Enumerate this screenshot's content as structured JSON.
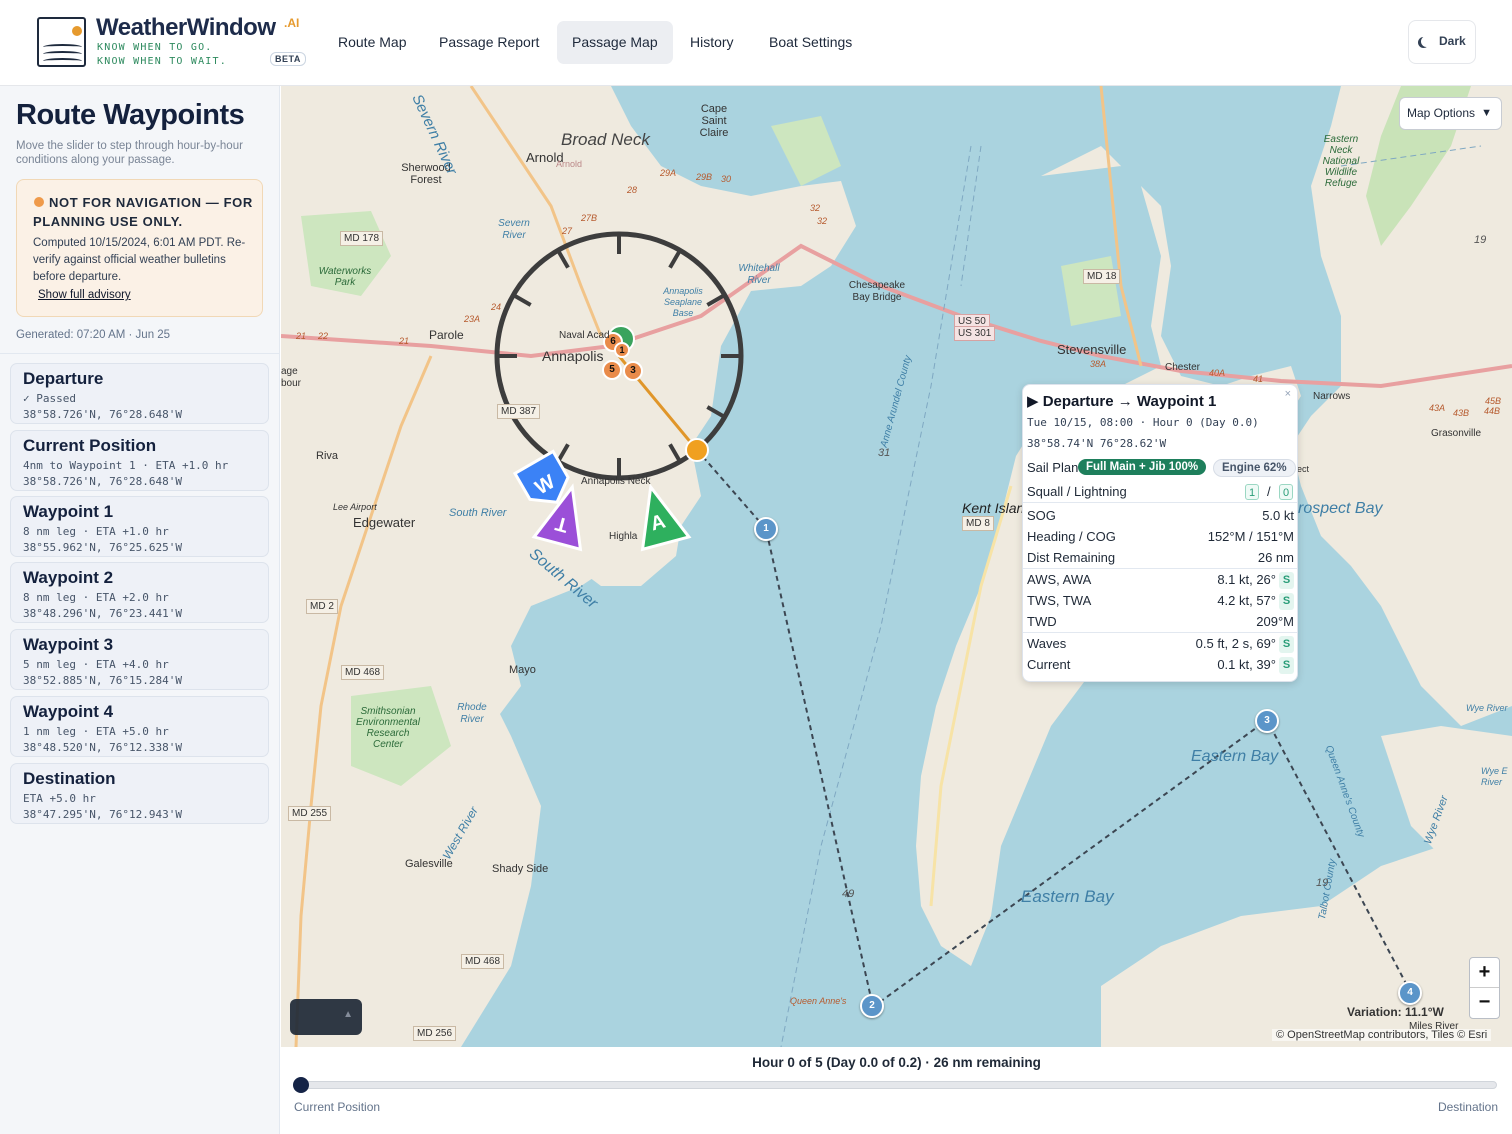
{
  "brand": {
    "name": "WeatherWindow",
    "suffix": ".AI",
    "tagline1": "KNOW WHEN TO GO.",
    "tagline2": "KNOW WHEN TO WAIT.",
    "badge": "BETA"
  },
  "nav": {
    "items": [
      "Route Map",
      "Passage Report",
      "Passage Map",
      "History",
      "Boat Settings"
    ],
    "active": "Passage Map",
    "theme_button": "Dark"
  },
  "sidebar": {
    "title": "Route Waypoints",
    "subtitle": "Move the slider to step through hour-by-hour conditions along your passage.",
    "advisory": {
      "heading": "NOT FOR NAVIGATION — FOR PLANNING USE ONLY.",
      "body": "Computed 10/15/2024, 6:01 AM PDT. Re-verify against official weather bulletins before departure.",
      "link": "Show full advisory",
      "dot_color": "#ef9a4a"
    },
    "generated": "Generated: 07:20 AM · Jun 25",
    "waypoints": [
      {
        "title": "Departure",
        "status": "✓ Passed",
        "coords": "38°58.726'N, 76°28.648'W"
      },
      {
        "title": "Current Position",
        "status": "4nm to Waypoint 1 · ETA +1.0 hr",
        "coords": "38°58.726'N, 76°28.648'W"
      },
      {
        "title": "Waypoint 1",
        "status": "8 nm leg · ETA +1.0 hr",
        "coords": "38°55.962'N, 76°25.625'W"
      },
      {
        "title": "Waypoint 2",
        "status": "8 nm leg · ETA +2.0 hr",
        "coords": "38°48.296'N, 76°23.441'W"
      },
      {
        "title": "Waypoint 3",
        "status": "5 nm leg · ETA +4.0 hr",
        "coords": "38°52.885'N, 76°15.284'W"
      },
      {
        "title": "Waypoint 4",
        "status": "1 nm leg · ETA +5.0 hr",
        "coords": "38°48.520'N, 76°12.338'W"
      },
      {
        "title": "Destination",
        "status": "ETA +5.0 hr",
        "coords": "38°47.295'N, 76°12.943'W"
      }
    ]
  },
  "map": {
    "options_label": "Map Options",
    "options_arrow": "▼",
    "zoom_in": "+",
    "zoom_out": "−",
    "attribution": "© OpenStreetMap contributors, Tiles © Esri",
    "variation": "Variation: 11.1°W",
    "legend_toggle": "▲",
    "wind_markers": {
      "apparent": "A",
      "true": "T",
      "wave": "W"
    },
    "waypoint_markers": [
      "1",
      "2",
      "3",
      "4"
    ],
    "cluster_markers": [
      "6",
      "5",
      "3",
      "1"
    ],
    "places": {
      "broad_neck": "Broad Neck",
      "arnold": "Arnold",
      "arnold2": "Arnold",
      "cape_saint_claire": "Cape Saint Claire",
      "sherwood_forest": "Sherwood Forest",
      "annapolis": "Annapolis",
      "naval_academy": "Naval Acad",
      "parole": "Parole",
      "riva": "Riva",
      "edgewater": "Edgewater",
      "annapolis_neck": "Annapolis Neck",
      "highland": "Highla",
      "mayo": "Mayo",
      "galesville": "Galesville",
      "shady_side": "Shady Side",
      "stevensville": "Stevensville",
      "chester": "Chester",
      "grasonville": "Grasonville",
      "narrows": "Narrows",
      "kent_island": "Kent Islan",
      "bay_bridge": "Chesapeake Bay Bridge",
      "lee_airport": "Lee Airport",
      "seaplane_base": "Annapolis Seaplane Base",
      "queen_annes": "Queen Anne's",
      "anne_arundel_county": "Anne Arundel County",
      "queen_annes_county": "Queen Anne's County",
      "talbot_county": "Talbot County",
      "age": "age",
      "bour": "bour",
      "ect": "ect",
      "miles_river": "Miles River"
    },
    "water": {
      "severn_river": "Severn River",
      "severn_river2": "Severn River",
      "whitehall_river": "Whitehall River",
      "south_river": "South River",
      "south_river2": "South River",
      "rhode_river": "Rhode River",
      "west_river": "West River",
      "eastern_bay": "Eastern Bay",
      "eastern_bay2": "Eastern Bay",
      "prospect_bay": "rospect Bay",
      "wye_river": "Wye River",
      "wye_river2": "Wye River",
      "wye_east": "Wye E River"
    },
    "green": {
      "waterworks": "Waterworks Park",
      "smithsonian": "Smithsonian Environmental Research Center",
      "eastern_neck": "Eastern Neck National Wildlife Refuge"
    },
    "shields": {
      "md178": "MD 178",
      "md18": "MD 18",
      "us50": "US 50",
      "us301": "US 301",
      "md387": "MD 387",
      "md2": "MD 2",
      "md468": "MD 468",
      "md468b": "MD 468",
      "md255": "MD 255",
      "md256": "MD 256",
      "md8": "MD 8"
    },
    "road_numbers": [
      "29A",
      "29B",
      "30",
      "28",
      "27B",
      "27",
      "32",
      "32",
      "24",
      "23A",
      "21",
      "22",
      "21",
      "38A",
      "40A",
      "41",
      "43A",
      "43B",
      "44B",
      "45B"
    ],
    "depths": [
      "19",
      "31",
      "49",
      "19"
    ]
  },
  "popup": {
    "title": "Departure → Waypoint 1",
    "time": "Tue 10/15, 08:00 · Hour 0  (Day 0.0)",
    "coords": "38°58.74'N 76°28.62'W",
    "sail_plan_label": "Sail Plan",
    "sail_plan": "Full Main + Jib 100%",
    "engine": "Engine 62%",
    "squall_label": "Squall / Lightning",
    "squall": "1",
    "squall_sep": "/",
    "lightning": "0",
    "rows": [
      {
        "k": "SOG",
        "v": "5.0 kt",
        "s": ""
      },
      {
        "k": "Heading / COG",
        "v": "152°M / 151°M",
        "s": ""
      },
      {
        "k": "Dist Remaining",
        "v": "26 nm",
        "s": ""
      },
      {
        "k": "AWS, AWA",
        "v": "8.1 kt, 26°",
        "s": "S"
      },
      {
        "k": "TWS, TWA",
        "v": "4.2 kt, 57°",
        "s": "S"
      },
      {
        "k": "TWD",
        "v": "209°M",
        "s": ""
      },
      {
        "k": "Waves",
        "v": "0.5 ft, 2 s, 69°",
        "s": "S"
      },
      {
        "k": "Current",
        "v": "0.1 kt, 39°",
        "s": "S"
      }
    ],
    "close": "×"
  },
  "slider": {
    "label": "Hour 0 of 5 (Day 0.0 of 0.2) · 26 nm remaining",
    "start": "Current Position",
    "end": "Destination",
    "value": 0,
    "max": 5
  },
  "colors": {
    "accent": "#152447",
    "route_marker": "#5b95c9",
    "current_marker": "#f0a020",
    "sail_badge": "#1e7f5c",
    "apparent_wind": "#2eb05e",
    "true_wind": "#9b4fd8",
    "wave_marker": "#3b82f6"
  }
}
